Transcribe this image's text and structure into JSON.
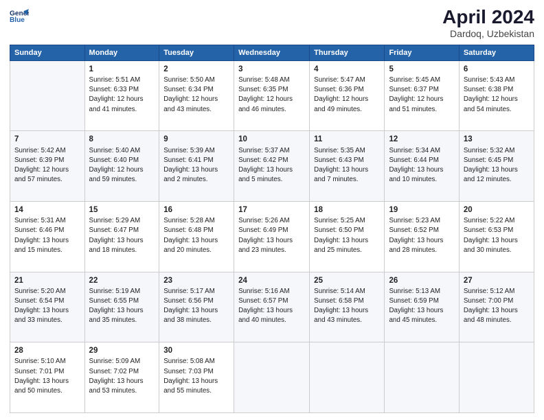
{
  "header": {
    "logo_line1": "General",
    "logo_line2": "Blue",
    "title": "April 2024",
    "subtitle": "Dardoq, Uzbekistan"
  },
  "columns": [
    "Sunday",
    "Monday",
    "Tuesday",
    "Wednesday",
    "Thursday",
    "Friday",
    "Saturday"
  ],
  "weeks": [
    [
      {
        "day": "",
        "info": ""
      },
      {
        "day": "1",
        "info": "Sunrise: 5:51 AM\nSunset: 6:33 PM\nDaylight: 12 hours\nand 41 minutes."
      },
      {
        "day": "2",
        "info": "Sunrise: 5:50 AM\nSunset: 6:34 PM\nDaylight: 12 hours\nand 43 minutes."
      },
      {
        "day": "3",
        "info": "Sunrise: 5:48 AM\nSunset: 6:35 PM\nDaylight: 12 hours\nand 46 minutes."
      },
      {
        "day": "4",
        "info": "Sunrise: 5:47 AM\nSunset: 6:36 PM\nDaylight: 12 hours\nand 49 minutes."
      },
      {
        "day": "5",
        "info": "Sunrise: 5:45 AM\nSunset: 6:37 PM\nDaylight: 12 hours\nand 51 minutes."
      },
      {
        "day": "6",
        "info": "Sunrise: 5:43 AM\nSunset: 6:38 PM\nDaylight: 12 hours\nand 54 minutes."
      }
    ],
    [
      {
        "day": "7",
        "info": "Sunrise: 5:42 AM\nSunset: 6:39 PM\nDaylight: 12 hours\nand 57 minutes."
      },
      {
        "day": "8",
        "info": "Sunrise: 5:40 AM\nSunset: 6:40 PM\nDaylight: 12 hours\nand 59 minutes."
      },
      {
        "day": "9",
        "info": "Sunrise: 5:39 AM\nSunset: 6:41 PM\nDaylight: 13 hours\nand 2 minutes."
      },
      {
        "day": "10",
        "info": "Sunrise: 5:37 AM\nSunset: 6:42 PM\nDaylight: 13 hours\nand 5 minutes."
      },
      {
        "day": "11",
        "info": "Sunrise: 5:35 AM\nSunset: 6:43 PM\nDaylight: 13 hours\nand 7 minutes."
      },
      {
        "day": "12",
        "info": "Sunrise: 5:34 AM\nSunset: 6:44 PM\nDaylight: 13 hours\nand 10 minutes."
      },
      {
        "day": "13",
        "info": "Sunrise: 5:32 AM\nSunset: 6:45 PM\nDaylight: 13 hours\nand 12 minutes."
      }
    ],
    [
      {
        "day": "14",
        "info": "Sunrise: 5:31 AM\nSunset: 6:46 PM\nDaylight: 13 hours\nand 15 minutes."
      },
      {
        "day": "15",
        "info": "Sunrise: 5:29 AM\nSunset: 6:47 PM\nDaylight: 13 hours\nand 18 minutes."
      },
      {
        "day": "16",
        "info": "Sunrise: 5:28 AM\nSunset: 6:48 PM\nDaylight: 13 hours\nand 20 minutes."
      },
      {
        "day": "17",
        "info": "Sunrise: 5:26 AM\nSunset: 6:49 PM\nDaylight: 13 hours\nand 23 minutes."
      },
      {
        "day": "18",
        "info": "Sunrise: 5:25 AM\nSunset: 6:50 PM\nDaylight: 13 hours\nand 25 minutes."
      },
      {
        "day": "19",
        "info": "Sunrise: 5:23 AM\nSunset: 6:52 PM\nDaylight: 13 hours\nand 28 minutes."
      },
      {
        "day": "20",
        "info": "Sunrise: 5:22 AM\nSunset: 6:53 PM\nDaylight: 13 hours\nand 30 minutes."
      }
    ],
    [
      {
        "day": "21",
        "info": "Sunrise: 5:20 AM\nSunset: 6:54 PM\nDaylight: 13 hours\nand 33 minutes."
      },
      {
        "day": "22",
        "info": "Sunrise: 5:19 AM\nSunset: 6:55 PM\nDaylight: 13 hours\nand 35 minutes."
      },
      {
        "day": "23",
        "info": "Sunrise: 5:17 AM\nSunset: 6:56 PM\nDaylight: 13 hours\nand 38 minutes."
      },
      {
        "day": "24",
        "info": "Sunrise: 5:16 AM\nSunset: 6:57 PM\nDaylight: 13 hours\nand 40 minutes."
      },
      {
        "day": "25",
        "info": "Sunrise: 5:14 AM\nSunset: 6:58 PM\nDaylight: 13 hours\nand 43 minutes."
      },
      {
        "day": "26",
        "info": "Sunrise: 5:13 AM\nSunset: 6:59 PM\nDaylight: 13 hours\nand 45 minutes."
      },
      {
        "day": "27",
        "info": "Sunrise: 5:12 AM\nSunset: 7:00 PM\nDaylight: 13 hours\nand 48 minutes."
      }
    ],
    [
      {
        "day": "28",
        "info": "Sunrise: 5:10 AM\nSunset: 7:01 PM\nDaylight: 13 hours\nand 50 minutes."
      },
      {
        "day": "29",
        "info": "Sunrise: 5:09 AM\nSunset: 7:02 PM\nDaylight: 13 hours\nand 53 minutes."
      },
      {
        "day": "30",
        "info": "Sunrise: 5:08 AM\nSunset: 7:03 PM\nDaylight: 13 hours\nand 55 minutes."
      },
      {
        "day": "",
        "info": ""
      },
      {
        "day": "",
        "info": ""
      },
      {
        "day": "",
        "info": ""
      },
      {
        "day": "",
        "info": ""
      }
    ]
  ]
}
